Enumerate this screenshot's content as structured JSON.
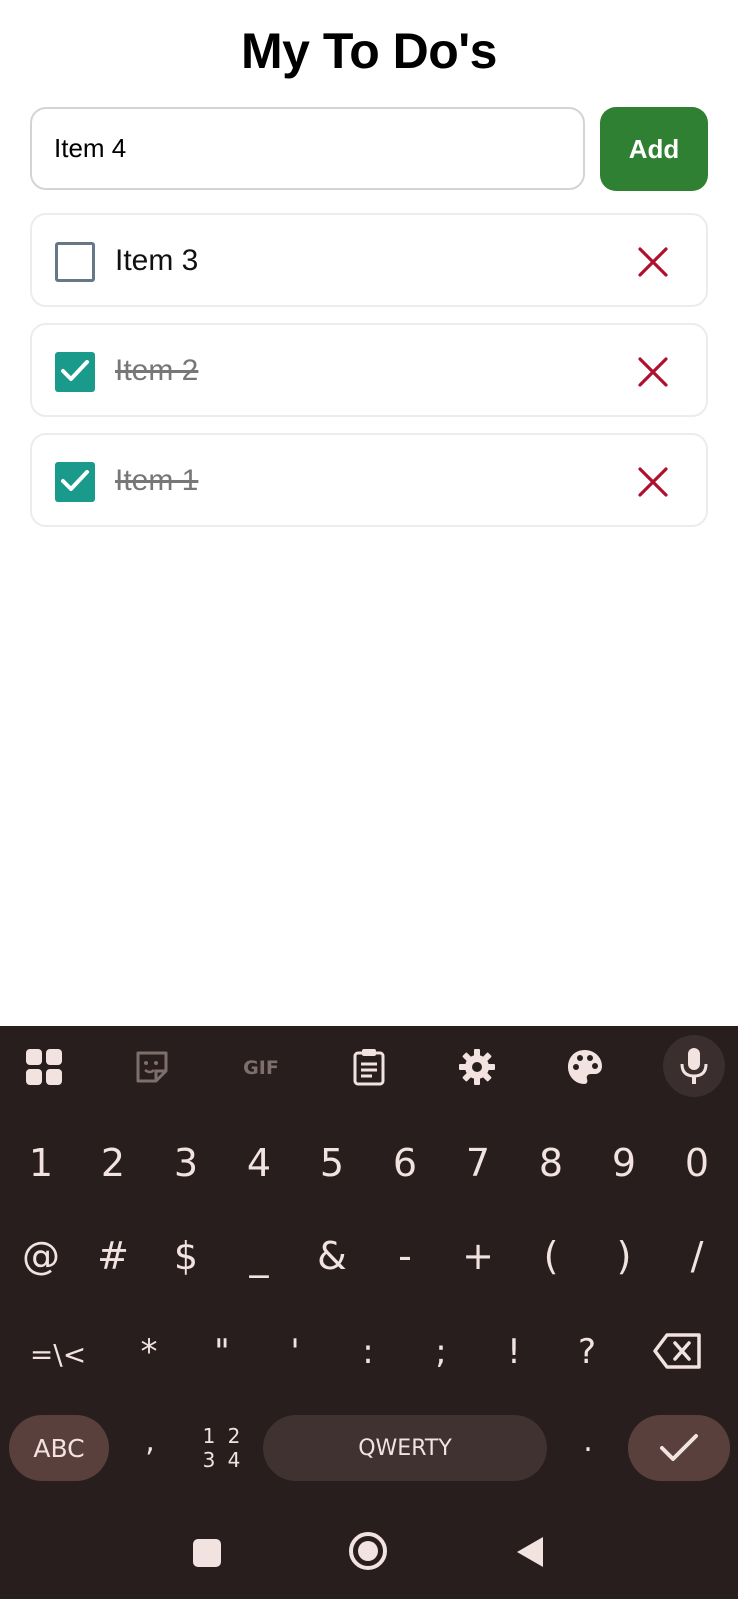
{
  "app": {
    "title": "My To Do's",
    "input": {
      "value": "Item 4",
      "placeholder": ""
    },
    "add_label": "Add",
    "todos": [
      {
        "label": "Item 3",
        "checked": false
      },
      {
        "label": "Item 2",
        "checked": true
      },
      {
        "label": "Item 1",
        "checked": true
      }
    ]
  },
  "colors": {
    "add_button": "#2f8032",
    "checkbox_checked": "#1a9a8a",
    "delete_icon": "#b0102e",
    "keyboard_bg": "#281e1e"
  },
  "keyboard": {
    "toolbar": [
      "apps-icon",
      "sticker-icon",
      "gif-icon",
      "clipboard-icon",
      "gear-icon",
      "palette-icon",
      "mic-icon"
    ],
    "row1": [
      "1",
      "2",
      "3",
      "4",
      "5",
      "6",
      "7",
      "8",
      "9",
      "0"
    ],
    "row2": [
      "@",
      "#",
      "$",
      "_",
      "&",
      "-",
      "+",
      "(",
      ")",
      "/"
    ],
    "row3": [
      "=\\<",
      "*",
      "\"",
      "'",
      ":",
      ";",
      "!",
      "?"
    ],
    "abc": "ABC",
    "comma": ",",
    "numpad": "12\n34",
    "space": "QWERTY",
    "period": "."
  },
  "navbar": [
    "recents-icon",
    "home-icon",
    "back-icon"
  ]
}
